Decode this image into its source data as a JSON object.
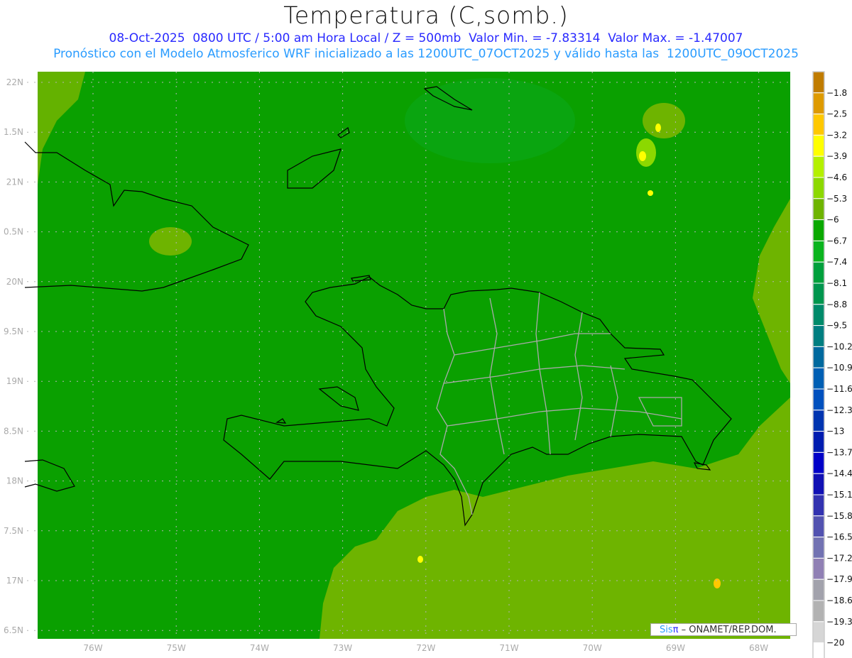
{
  "title": "Temperatura (C,somb.)",
  "subtitle_line1": "08-Oct-2025  0800 UTC / 5:00 am Hora Local / Z = 500mb  Valor Min. = -7.83314  Valor Max. = -1.47007",
  "subtitle_line2": "Pronóstico con el Modelo Atmosferico WRF inicializado a las 1200UTC_07OCT2025 y válido hasta las  1200UTC_09OCT2025",
  "axes": {
    "lon_labels": [
      "76W",
      "75W",
      "74W",
      "73W",
      "72W",
      "71W",
      "70W",
      "69W",
      "68W"
    ],
    "lat_labels": [
      "22N",
      "1.5N",
      "21N",
      "0.5N",
      "20N",
      "9.5N",
      "19N",
      "8.5N",
      "18N",
      "7.5N",
      "17N",
      "6.5N"
    ]
  },
  "colorbar": {
    "labels": [
      "-1.8",
      "-2.5",
      "-3.2",
      "-3.9",
      "-4.6",
      "-5.3",
      "-6",
      "-6.7",
      "-7.4",
      "-8.1",
      "-8.8",
      "-9.5",
      "-10.2",
      "-10.9",
      "-11.6",
      "-12.3",
      "-13",
      "-13.7",
      "-14.4",
      "-15.1",
      "-15.8",
      "-16.5",
      "-17.2",
      "-17.9",
      "-18.6",
      "-19.3",
      "-20"
    ],
    "colors": [
      "#c07c00",
      "#de9a00",
      "#ffc800",
      "#ffff00",
      "#b4f000",
      "#8cd800",
      "#6eb400",
      "#0aa800",
      "#0ab41e",
      "#00a03c",
      "#00964e",
      "#008a6a",
      "#007e80",
      "#00699e",
      "#005fb4",
      "#0050be",
      "#0034b0",
      "#001cb0",
      "#0000c8",
      "#1010b4",
      "#3232b0",
      "#5252b0",
      "#7272b2",
      "#9080b4",
      "#a2a2ac",
      "#b2b2b2",
      "#d6d6d6",
      "#ffffff"
    ]
  },
  "field_colors": {
    "base": "#0aa000",
    "warm": "#6eb400",
    "warmer": "#8cd800"
  },
  "credit": {
    "brand_a": "Sis",
    "brand_b": "π",
    "text": " – ONAMET/REP.DOM."
  }
}
